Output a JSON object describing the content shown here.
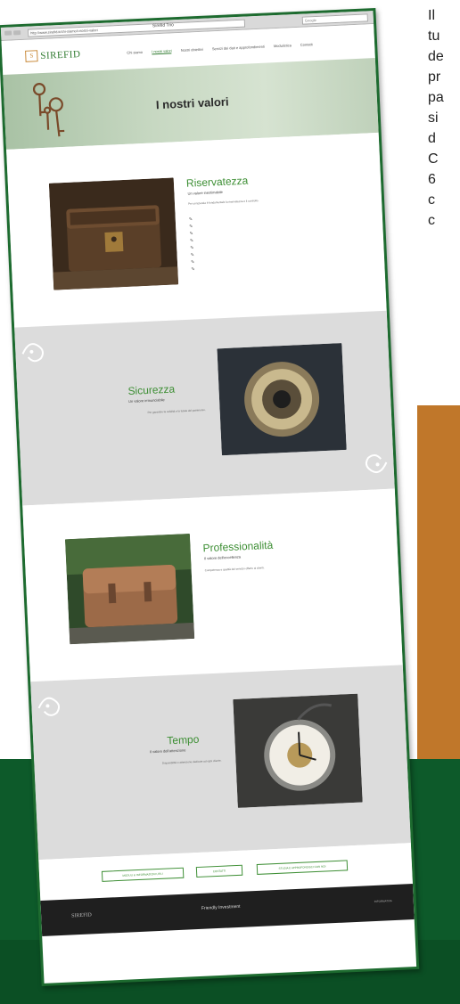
{
  "side_text": {
    "lines": [
      "Il",
      "tu",
      "de",
      "pr",
      "pa",
      "si",
      "d",
      "C",
      "6",
      "c",
      "c"
    ]
  },
  "browser": {
    "tab_title": "Sirefid Trio",
    "url": "http://www.sirefid.it/chi-siamo/i-nostri-valori",
    "search_placeholder": "Google"
  },
  "site": {
    "logo_mark": "S",
    "logo_text": "SIREFID",
    "nav": [
      "Chi siamo",
      "I nostri valori",
      "Nostri obiettivi",
      "Servizi dei dati e approfondimenti",
      "Modulistica",
      "Contatti"
    ],
    "active_nav_index": 1,
    "hero_title": "I nostri valori"
  },
  "sections": [
    {
      "title": "Riservatezza",
      "subtitle": "Un valore inestimabile",
      "body": "Per un'azienda è fondamentale la riservatezza e il controllo.",
      "bullets": [
        "",
        "",
        "",
        "",
        "",
        "",
        "",
        ""
      ]
    },
    {
      "title": "Sicurezza",
      "subtitle": "Un valore irrinunciabile",
      "body": "Per garantire la solidità e la tutela del patrimonio."
    },
    {
      "title": "Professionalità",
      "subtitle": "Il valore dell'eccellenza",
      "body": "Competenza e qualità del servizio offerto ai clienti."
    },
    {
      "title": "Tempo",
      "subtitle": "Il valore dell'attenzione",
      "body": "Disponibilità e attenzione dedicate ad ogni cliente."
    }
  ],
  "buttons": [
    "MODULI & INFORMAZIONI UTILI",
    "CONTATTI",
    "STUDIA E APPROFONDISCI CON NOI"
  ],
  "footer": {
    "left": "SIREFID",
    "center": "Friendly Investment",
    "right": "INFORMATIVA"
  },
  "colors": {
    "frame_green": "#1d6b2f",
    "accent_green": "#3e8f35",
    "orange_band": "#c0772a",
    "bottom_green": "#0d5a2a"
  }
}
